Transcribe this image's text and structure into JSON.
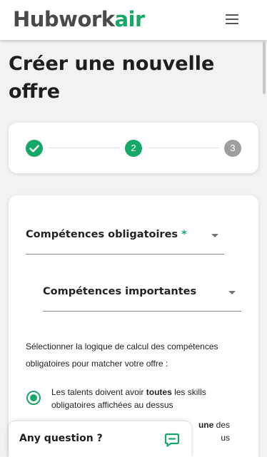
{
  "header": {
    "logo_part1": "Hubwork",
    "logo_part2": "air",
    "menu_icon": "hamburger-menu-icon"
  },
  "page": {
    "title": "Créer une nouvelle offre"
  },
  "stepper": {
    "steps": [
      {
        "label": "",
        "state": "completed",
        "icon": "check-icon"
      },
      {
        "label": "2",
        "state": "active"
      },
      {
        "label": "3",
        "state": "todo"
      }
    ]
  },
  "form": {
    "required_skills_label": "Compétences obligatoires",
    "required_marker": "*",
    "important_skills_label": "Compétences importantes",
    "logic_description": "Sélectionner la logique de calcul des compétences obligatoires pour matcher votre offre :",
    "option_all": {
      "pre": "Les talents doivent avoir ",
      "bold": "toutes",
      "post": " les skills obligatoires affichées au dessus",
      "selected": true
    },
    "option_one": {
      "bold": "une",
      "post": " des",
      "line2": "us"
    }
  },
  "chat": {
    "label": "Any question ?",
    "icon": "chat-bubble-icon"
  },
  "colors": {
    "accent": "#17a869",
    "inactive_step": "#9e9e9e",
    "logo_dark": "#4a4a4a"
  }
}
